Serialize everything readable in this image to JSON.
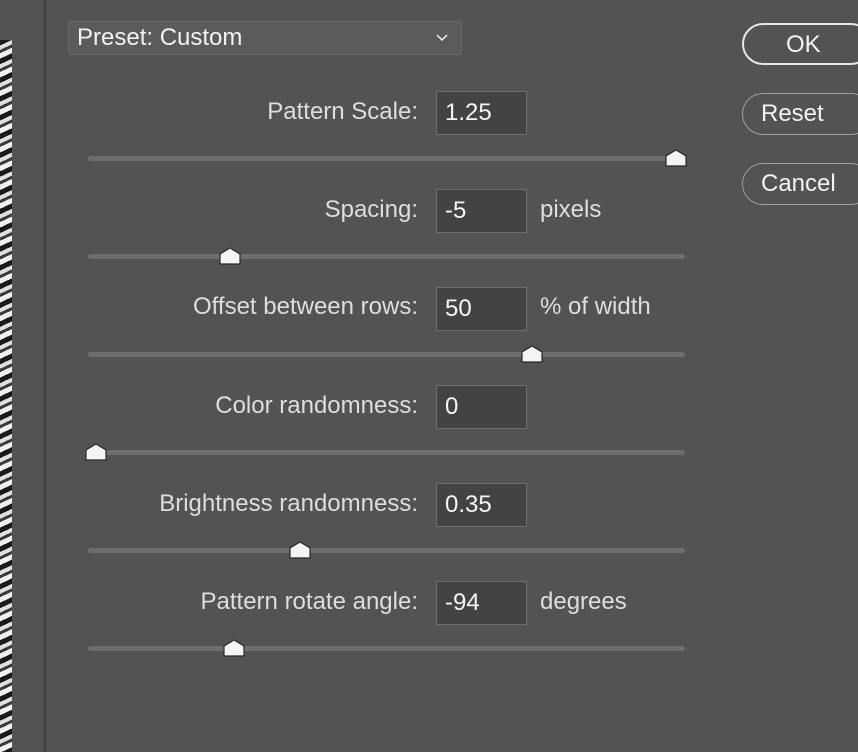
{
  "preset": {
    "label": "Preset: Custom"
  },
  "buttons": {
    "ok": "OK",
    "reset": "Reset",
    "cancel": "Cancel"
  },
  "rows": [
    {
      "label": "Pattern Scale:",
      "value": "1.25",
      "unit": "",
      "slider_fraction": 0.985
    },
    {
      "label": "Spacing:",
      "value": "-5",
      "unit": "pixels",
      "slider_fraction": 0.238
    },
    {
      "label": "Offset between rows:",
      "value": "50",
      "unit": "% of width",
      "slider_fraction": 0.744
    },
    {
      "label": "Color randomness:",
      "value": "0",
      "unit": "",
      "slider_fraction": 0.013
    },
    {
      "label": "Brightness randomness:",
      "value": "0.35",
      "unit": "",
      "slider_fraction": 0.355
    },
    {
      "label": "Pattern rotate angle:",
      "value": "-94",
      "unit": "degrees",
      "slider_fraction": 0.245
    }
  ],
  "icons": {
    "preset_dropdown": "chevron-down-icon",
    "slider_thumb": "slider-thumb-icon"
  },
  "colors": {
    "background": "#535353",
    "field_background": "#434343",
    "text": "#dedede"
  }
}
